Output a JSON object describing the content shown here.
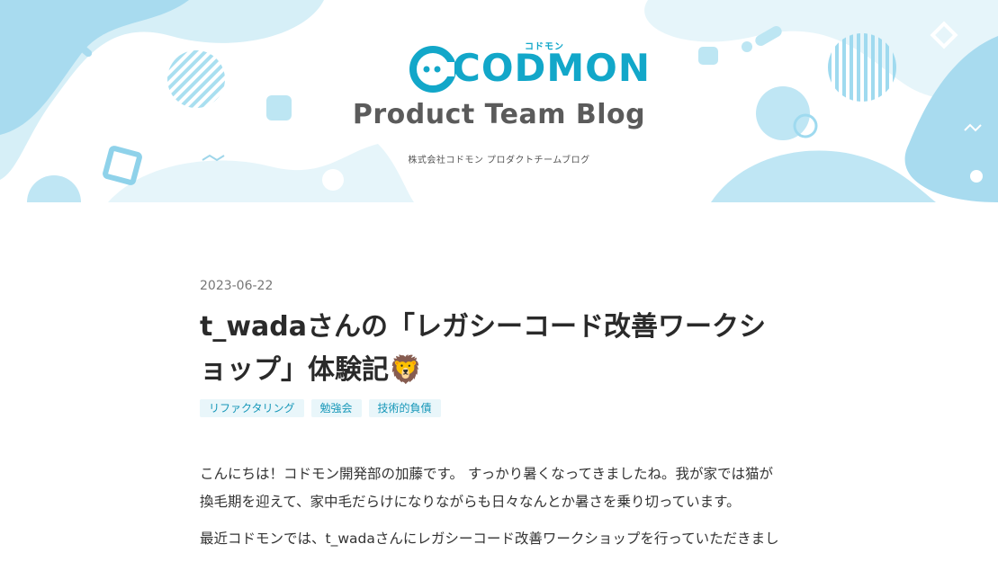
{
  "header": {
    "logo_text": "CODMON",
    "logo_kana": "コドモン",
    "blog_title": "Product Team Blog",
    "blog_subtitle": "株式会社コドモン プロダクトチームブログ"
  },
  "article": {
    "date": "2023-06-22",
    "title_line1": "t_wadaさんの「レガシーコード改善ワークシ",
    "title_line2": "ョップ」体験記🦁",
    "tags": [
      "リファクタリング",
      "勉強会",
      "技術的負債"
    ],
    "paragraph1": "こんにちは！コドモン開発部の加藤です。 すっかり暑くなってきましたね。我が家では猫が換毛期を迎えて、家中毛だらけになりながらも日々なんとか暑さを乗り切っています。",
    "paragraph2": "最近コドモンでは、t_wadaさんにレガシーコード改善ワークショップを行っていただきまし"
  },
  "colors": {
    "brand": "#12a7c9",
    "tag_bg": "#e9f6fa",
    "tag_text": "#1697b8"
  }
}
